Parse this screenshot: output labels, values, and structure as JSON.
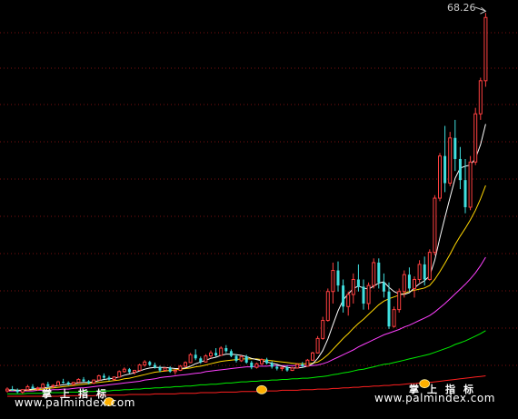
{
  "watermark": {
    "title": "掌上指标",
    "url": "www.palmindex.com"
  },
  "peak_label": "68.26",
  "colors": {
    "background": "#000000",
    "grid": "#7a1010",
    "up": "#ff4040",
    "down": "#40e0e0",
    "ma_short": "#ffffff",
    "ma_mid": "#ffd700",
    "ma_long": "#ff40ff",
    "ma_green": "#00ee00",
    "ma_red": "#ff2020",
    "marker": "#ffb000"
  },
  "chart_data": {
    "type": "candlestick",
    "high_label": 68.26,
    "ylim": [
      4.0,
      69.5
    ],
    "grid": true,
    "candles": [
      [
        5.5,
        6.1,
        5.2,
        5.8
      ],
      [
        5.8,
        6.3,
        5.5,
        5.6
      ],
      [
        5.6,
        5.9,
        5.1,
        5.3
      ],
      [
        5.3,
        5.8,
        5.0,
        5.7
      ],
      [
        5.7,
        6.5,
        5.6,
        6.2
      ],
      [
        6.2,
        6.6,
        5.8,
        5.9
      ],
      [
        5.9,
        6.2,
        5.5,
        6.0
      ],
      [
        6.0,
        6.8,
        5.9,
        6.6
      ],
      [
        6.6,
        7.0,
        6.1,
        6.3
      ],
      [
        6.3,
        6.6,
        5.9,
        6.4
      ],
      [
        6.4,
        7.2,
        6.3,
        7.0
      ],
      [
        7.0,
        7.5,
        6.7,
        6.9
      ],
      [
        6.9,
        7.1,
        6.4,
        6.6
      ],
      [
        6.6,
        7.0,
        6.3,
        6.9
      ],
      [
        6.9,
        7.6,
        6.8,
        7.4
      ],
      [
        7.4,
        7.8,
        7.0,
        7.1
      ],
      [
        7.1,
        7.3,
        6.6,
        6.8
      ],
      [
        6.8,
        7.4,
        6.6,
        7.3
      ],
      [
        7.3,
        8.2,
        7.2,
        8.0
      ],
      [
        8.0,
        8.4,
        7.5,
        7.7
      ],
      [
        7.7,
        8.0,
        7.2,
        7.4
      ],
      [
        7.4,
        7.9,
        7.2,
        7.8
      ],
      [
        7.8,
        8.9,
        7.7,
        8.7
      ],
      [
        8.7,
        9.4,
        8.5,
        9.1
      ],
      [
        9.1,
        9.3,
        8.4,
        8.6
      ],
      [
        8.6,
        9.0,
        8.2,
        8.9
      ],
      [
        8.9,
        10.0,
        8.8,
        9.8
      ],
      [
        9.8,
        10.6,
        9.5,
        10.3
      ],
      [
        10.3,
        10.5,
        9.6,
        9.8
      ],
      [
        9.8,
        10.2,
        9.2,
        9.4
      ],
      [
        9.4,
        9.7,
        8.6,
        8.9
      ],
      [
        8.9,
        9.4,
        8.7,
        9.3
      ],
      [
        9.3,
        9.6,
        8.5,
        8.7
      ],
      [
        8.7,
        9.1,
        8.2,
        8.9
      ],
      [
        8.9,
        9.8,
        8.8,
        9.6
      ],
      [
        9.6,
        10.4,
        9.4,
        10.2
      ],
      [
        10.2,
        11.8,
        10.1,
        11.5
      ],
      [
        11.5,
        12.4,
        10.6,
        10.9
      ],
      [
        10.9,
        11.2,
        10.0,
        10.3
      ],
      [
        10.3,
        11.6,
        10.2,
        11.3
      ],
      [
        11.3,
        12.2,
        10.9,
        11.8
      ],
      [
        11.8,
        12.6,
        11.2,
        11.4
      ],
      [
        11.4,
        12.9,
        11.3,
        12.6
      ],
      [
        12.6,
        13.1,
        11.8,
        12.1
      ],
      [
        12.1,
        12.4,
        11.1,
        11.3
      ],
      [
        11.3,
        11.6,
        10.2,
        10.5
      ],
      [
        10.5,
        11.4,
        10.3,
        11.2
      ],
      [
        11.2,
        11.5,
        10.0,
        10.2
      ],
      [
        10.2,
        10.5,
        9.1,
        9.4
      ],
      [
        9.4,
        10.2,
        9.2,
        10.0
      ],
      [
        10.0,
        10.9,
        9.8,
        10.7
      ],
      [
        10.7,
        11.0,
        9.9,
        10.1
      ],
      [
        10.1,
        10.4,
        9.2,
        9.5
      ],
      [
        9.5,
        9.8,
        8.9,
        9.2
      ],
      [
        9.2,
        9.6,
        8.8,
        9.4
      ],
      [
        9.4,
        9.7,
        8.7,
        8.9
      ],
      [
        8.9,
        9.5,
        8.8,
        9.3
      ],
      [
        9.3,
        10.1,
        9.2,
        9.9
      ],
      [
        9.9,
        10.3,
        9.4,
        9.6
      ],
      [
        9.6,
        10.8,
        9.5,
        10.6
      ],
      [
        10.6,
        12.0,
        10.5,
        11.8
      ],
      [
        11.8,
        14.6,
        11.7,
        14.2
      ],
      [
        14.2,
        17.8,
        14.0,
        17.2
      ],
      [
        17.2,
        22.5,
        17.0,
        22.0
      ],
      [
        22.0,
        26.8,
        20.0,
        25.5
      ],
      [
        25.5,
        27.0,
        22.0,
        23.0
      ],
      [
        23.0,
        24.0,
        18.5,
        19.5
      ],
      [
        19.5,
        22.0,
        18.0,
        21.5
      ],
      [
        21.5,
        25.0,
        20.0,
        24.0
      ],
      [
        24.0,
        26.5,
        22.0,
        22.8
      ],
      [
        22.8,
        24.0,
        19.0,
        20.0
      ],
      [
        20.0,
        23.5,
        19.0,
        23.0
      ],
      [
        23.0,
        27.5,
        22.5,
        26.8
      ],
      [
        26.8,
        27.5,
        22.5,
        23.5
      ],
      [
        23.5,
        25.0,
        21.0,
        22.0
      ],
      [
        22.0,
        23.5,
        15.8,
        16.2
      ],
      [
        16.2,
        19.5,
        16.0,
        19.0
      ],
      [
        19.0,
        22.5,
        18.5,
        22.0
      ],
      [
        22.0,
        25.5,
        21.0,
        24.8
      ],
      [
        24.8,
        26.0,
        22.0,
        22.5
      ],
      [
        22.5,
        24.5,
        21.0,
        24.0
      ],
      [
        24.0,
        27.2,
        23.5,
        26.5
      ],
      [
        26.5,
        27.8,
        23.0,
        24.0
      ],
      [
        24.0,
        29.0,
        23.8,
        28.5
      ],
      [
        28.5,
        38.0,
        28.0,
        37.5
      ],
      [
        37.5,
        45.0,
        37.0,
        44.5
      ],
      [
        44.5,
        49.5,
        38.5,
        40.0
      ],
      [
        40.0,
        48.5,
        39.5,
        47.5
      ],
      [
        47.5,
        50.5,
        42.0,
        44.0
      ],
      [
        44.0,
        46.0,
        39.0,
        40.5
      ],
      [
        40.5,
        44.0,
        35.0,
        36.0
      ],
      [
        36.0,
        44.5,
        35.5,
        43.5
      ],
      [
        43.5,
        52.5,
        43.0,
        51.5
      ],
      [
        51.5,
        57.5,
        50.5,
        57.0
      ],
      [
        57.0,
        68.26,
        56.0,
        67.5
      ]
    ],
    "ma_short": [
      5.6,
      5.7,
      5.6,
      5.6,
      5.7,
      5.8,
      5.9,
      6.0,
      6.1,
      6.2,
      6.4,
      6.5,
      6.6,
      6.7,
      6.8,
      6.9,
      6.9,
      7.0,
      7.2,
      7.4,
      7.5,
      7.6,
      7.8,
      8.1,
      8.3,
      8.5,
      8.8,
      9.1,
      9.3,
      9.4,
      9.4,
      9.4,
      9.3,
      9.2,
      9.2,
      9.3,
      9.6,
      10.0,
      10.3,
      10.6,
      10.9,
      11.1,
      11.4,
      11.6,
      11.6,
      11.5,
      11.4,
      11.2,
      10.9,
      10.7,
      10.5,
      10.3,
      10.1,
      9.9,
      9.6,
      9.4,
      9.3,
      9.3,
      9.4,
      9.6,
      10.0,
      10.9,
      12.2,
      14.1,
      16.5,
      18.8,
      20.6,
      21.6,
      22.5,
      22.9,
      22.6,
      22.4,
      22.9,
      23.4,
      23.6,
      22.7,
      22.0,
      21.6,
      21.5,
      21.8,
      22.6,
      23.3,
      23.8,
      24.6,
      27.2,
      30.9,
      34.3,
      37.6,
      40.8,
      42.5,
      42.8,
      43.0,
      44.1,
      46.4,
      49.8
    ],
    "ma_mid": [
      5.6,
      5.6,
      5.6,
      5.6,
      5.6,
      5.7,
      5.7,
      5.8,
      5.9,
      6.0,
      6.1,
      6.2,
      6.3,
      6.4,
      6.5,
      6.6,
      6.7,
      6.8,
      6.9,
      7.0,
      7.1,
      7.2,
      7.3,
      7.5,
      7.6,
      7.8,
      8.0,
      8.2,
      8.4,
      8.6,
      8.7,
      8.8,
      8.9,
      9.0,
      9.1,
      9.2,
      9.3,
      9.5,
      9.6,
      9.8,
      10.0,
      10.2,
      10.4,
      10.5,
      10.6,
      10.7,
      10.8,
      10.8,
      10.8,
      10.8,
      10.7,
      10.6,
      10.5,
      10.4,
      10.3,
      10.2,
      10.1,
      10.0,
      10.0,
      10.0,
      10.1,
      10.3,
      10.8,
      11.5,
      12.4,
      13.3,
      14.2,
      15.0,
      15.9,
      16.7,
      17.4,
      18.2,
      19.0,
      19.8,
      20.4,
      20.8,
      21.1,
      21.4,
      21.7,
      22.0,
      22.2,
      22.4,
      22.6,
      23.0,
      24.0,
      25.3,
      26.7,
      28.2,
      29.8,
      31.2,
      32.5,
      33.9,
      35.5,
      37.4,
      39.6
    ],
    "ma_long": [
      5.5,
      5.5,
      5.5,
      5.5,
      5.5,
      5.5,
      5.6,
      5.6,
      5.6,
      5.7,
      5.7,
      5.8,
      5.8,
      5.9,
      6.0,
      6.0,
      6.1,
      6.2,
      6.3,
      6.4,
      6.5,
      6.6,
      6.7,
      6.8,
      6.9,
      7.0,
      7.1,
      7.3,
      7.4,
      7.5,
      7.7,
      7.8,
      7.9,
      8.0,
      8.1,
      8.2,
      8.3,
      8.4,
      8.5,
      8.7,
      8.8,
      8.9,
      9.0,
      9.1,
      9.2,
      9.3,
      9.4,
      9.5,
      9.5,
      9.6,
      9.6,
      9.6,
      9.7,
      9.7,
      9.7,
      9.7,
      9.7,
      9.7,
      9.7,
      9.7,
      9.7,
      9.8,
      10.0,
      10.3,
      10.7,
      11.1,
      11.5,
      11.9,
      12.3,
      12.8,
      13.2,
      13.6,
      14.0,
      14.4,
      14.8,
      15.1,
      15.4,
      15.7,
      16.1,
      16.4,
      16.8,
      17.2,
      17.6,
      18.0,
      18.6,
      19.3,
      20.0,
      20.8,
      21.6,
      22.4,
      23.2,
      24.1,
      25.1,
      26.3,
      27.7
    ],
    "ma_green": [
      5.0,
      5.0,
      5.0,
      5.0,
      5.1,
      5.1,
      5.1,
      5.1,
      5.2,
      5.2,
      5.2,
      5.2,
      5.3,
      5.3,
      5.3,
      5.4,
      5.4,
      5.4,
      5.5,
      5.5,
      5.5,
      5.6,
      5.6,
      5.7,
      5.7,
      5.8,
      5.8,
      5.9,
      5.9,
      6.0,
      6.0,
      6.1,
      6.1,
      6.2,
      6.2,
      6.3,
      6.3,
      6.4,
      6.5,
      6.5,
      6.6,
      6.6,
      6.7,
      6.8,
      6.8,
      6.9,
      7.0,
      7.0,
      7.1,
      7.1,
      7.2,
      7.2,
      7.3,
      7.3,
      7.4,
      7.4,
      7.5,
      7.5,
      7.6,
      7.6,
      7.7,
      7.8,
      7.9,
      8.0,
      8.2,
      8.3,
      8.5,
      8.6,
      8.8,
      9.0,
      9.1,
      9.3,
      9.5,
      9.7,
      9.9,
      10.0,
      10.2,
      10.4,
      10.6,
      10.8,
      11.0,
      11.2,
      11.4,
      11.6,
      11.9,
      12.2,
      12.5,
      12.8,
      13.2,
      13.5,
      13.8,
      14.2,
      14.6,
      15.0,
      15.5
    ],
    "ma_red": [
      4.6,
      4.6,
      4.6,
      4.6,
      4.6,
      4.6,
      4.6,
      4.6,
      4.6,
      4.6,
      4.6,
      4.7,
      4.7,
      4.7,
      4.7,
      4.7,
      4.7,
      4.7,
      4.8,
      4.8,
      4.8,
      4.8,
      4.8,
      4.8,
      4.9,
      4.9,
      4.9,
      4.9,
      4.9,
      5.0,
      5.0,
      5.0,
      5.0,
      5.0,
      5.1,
      5.1,
      5.1,
      5.1,
      5.2,
      5.2,
      5.2,
      5.2,
      5.3,
      5.3,
      5.3,
      5.3,
      5.4,
      5.4,
      5.4,
      5.4,
      5.5,
      5.5,
      5.5,
      5.5,
      5.6,
      5.6,
      5.6,
      5.6,
      5.7,
      5.7,
      5.7,
      5.8,
      5.8,
      5.8,
      5.9,
      5.9,
      6.0,
      6.0,
      6.1,
      6.1,
      6.2,
      6.2,
      6.3,
      6.3,
      6.4,
      6.4,
      6.5,
      6.5,
      6.6,
      6.7,
      6.7,
      6.8,
      6.9,
      6.9,
      7.0,
      7.1,
      7.2,
      7.3,
      7.4,
      7.5,
      7.6,
      7.7,
      7.8,
      7.9,
      8.0
    ],
    "markers": [
      [
        20,
        5.5
      ],
      [
        50,
        7.5
      ],
      [
        82,
        8.5
      ]
    ]
  }
}
